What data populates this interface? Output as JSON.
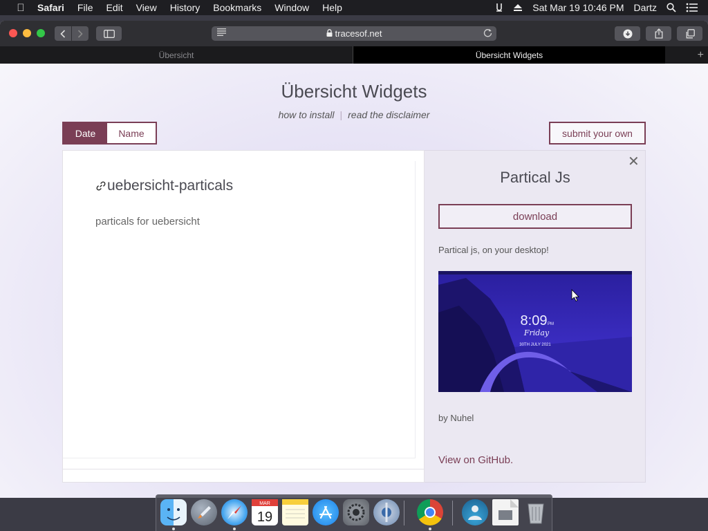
{
  "menubar": {
    "app": "Safari",
    "menus": [
      "File",
      "Edit",
      "View",
      "History",
      "Bookmarks",
      "Window",
      "Help"
    ],
    "datetime": "Sat Mar 19  10:46 PM",
    "user": "Dartz"
  },
  "browser": {
    "url": "tracesof.net",
    "tabs": [
      {
        "label": "Übersicht",
        "active": false
      },
      {
        "label": "Übersicht Widgets",
        "active": true
      }
    ],
    "new_tab": "+"
  },
  "page": {
    "title": "Übersicht Widgets",
    "links": {
      "install": "how to install",
      "separator": "|",
      "disclaimer": "read the disclaimer"
    },
    "sort": {
      "date": "Date",
      "name": "Name",
      "active": "Date"
    },
    "submit_label": "submit your own",
    "accent_color": "#7a3e55"
  },
  "widget_list": [
    {
      "name": "uebersicht-particals",
      "description": "particals for uebersicht"
    }
  ],
  "detail": {
    "close": "✕",
    "title": "Partical Js",
    "download_label": "download",
    "description": "Partical js, on your desktop!",
    "preview": {
      "time": "8:09",
      "ampm": "PM",
      "day": "Friday",
      "date": "30TH JULY 2021"
    },
    "author": "by Nuhel",
    "github_label": "View on GitHub."
  },
  "dock": {
    "calendar_month": "MAR",
    "calendar_day": "19",
    "apps": [
      "finder-icon",
      "launchpad-icon",
      "safari-icon",
      "calendar-icon",
      "notes-icon",
      "app-store-icon",
      "system-preferences-icon",
      "disk-utility-icon",
      "chrome-icon",
      "migration-icon",
      "preview-file-icon",
      "trash-icon"
    ]
  }
}
